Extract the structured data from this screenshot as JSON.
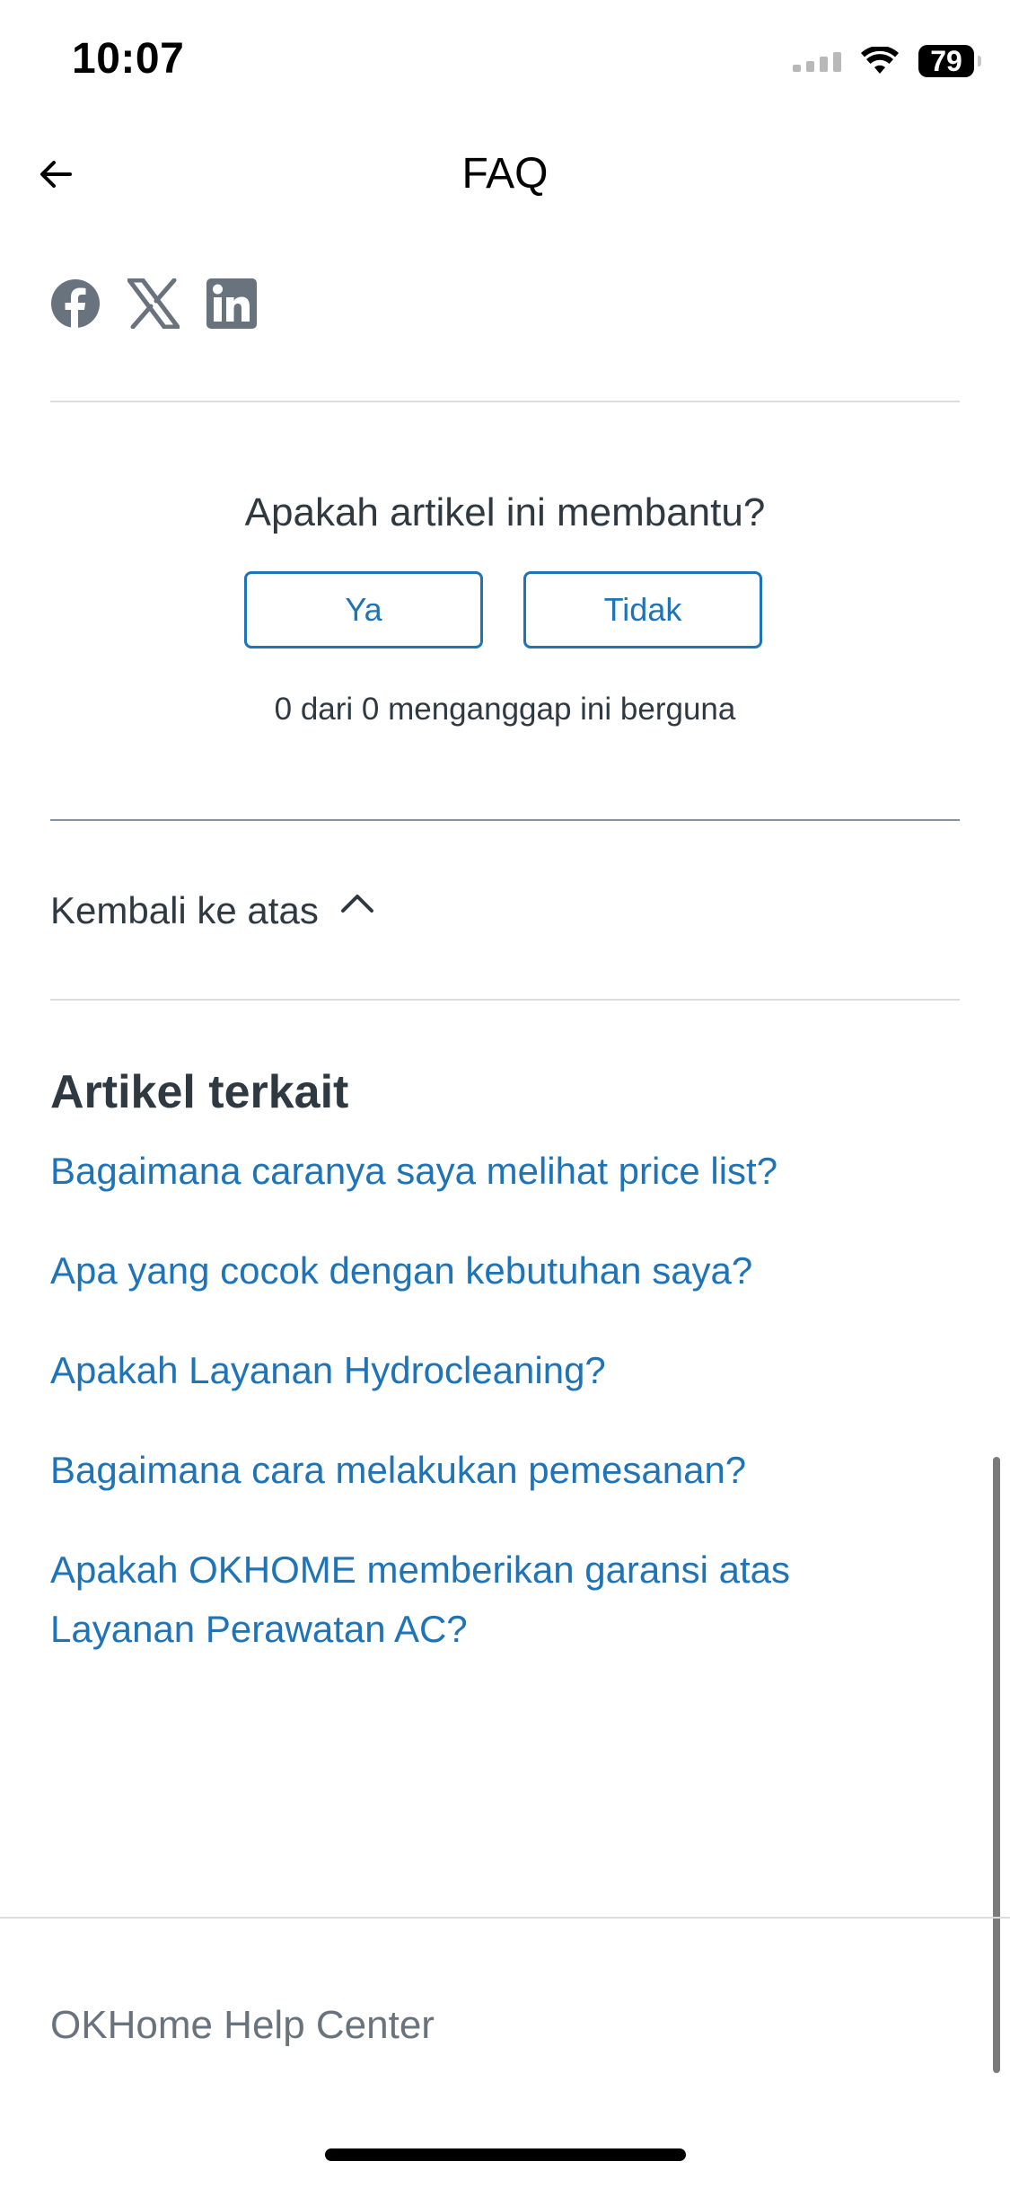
{
  "status": {
    "time": "10:07",
    "battery": "79"
  },
  "header": {
    "title": "FAQ"
  },
  "social": {
    "icons": [
      "facebook-icon",
      "x-icon",
      "linkedin-icon"
    ]
  },
  "feedback": {
    "question": "Apakah artikel ini membantu?",
    "yes_label": "Ya",
    "no_label": "Tidak",
    "count_text": "0 dari 0 menganggap ini berguna"
  },
  "back_to_top": {
    "label": "Kembali ke atas"
  },
  "related": {
    "title": "Artikel terkait",
    "links": [
      "Bagaimana caranya saya melihat price list?",
      "Apa yang cocok dengan kebutuhan saya?",
      "Apakah Layanan Hydrocleaning?",
      "Bagaimana cara melakukan pemesanan?",
      "Apakah OKHOME memberikan garansi atas Layanan Perawatan AC?"
    ]
  },
  "footer": {
    "text": "OKHome Help Center"
  },
  "colors": {
    "link": "#1f73b7",
    "text": "#2f3941",
    "muted": "#68737d"
  }
}
